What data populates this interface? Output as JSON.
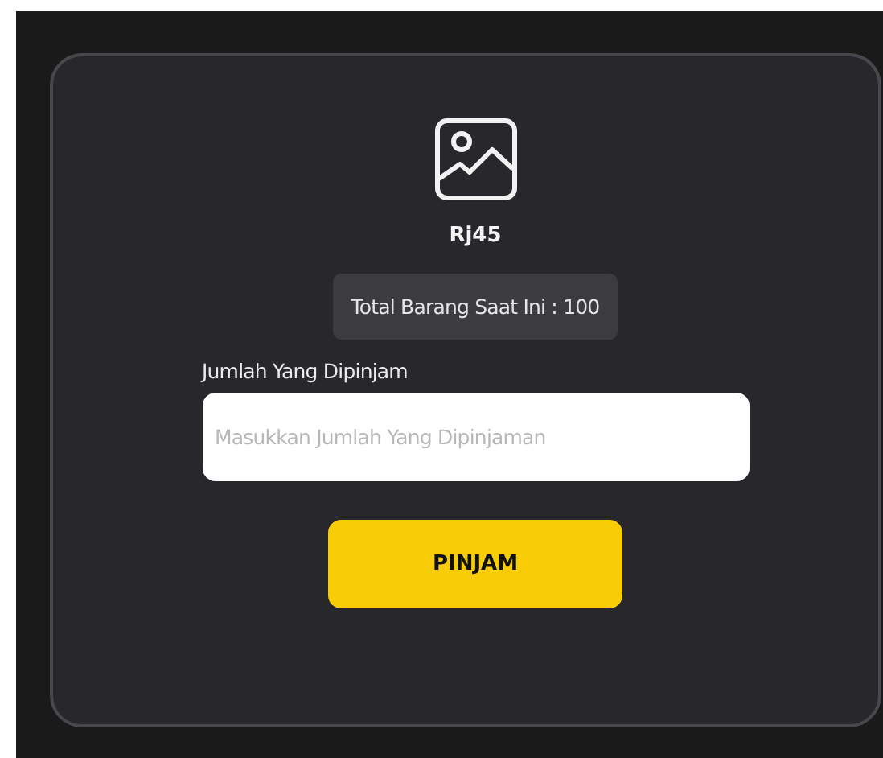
{
  "item": {
    "name": "Rj45",
    "stock_text": "Total Barang Saat Ini : 100"
  },
  "form": {
    "label": "Jumlah Yang Dipinjam",
    "placeholder": "Masukkan Jumlah Yang Dipinjaman",
    "submit": "PINJAM"
  }
}
